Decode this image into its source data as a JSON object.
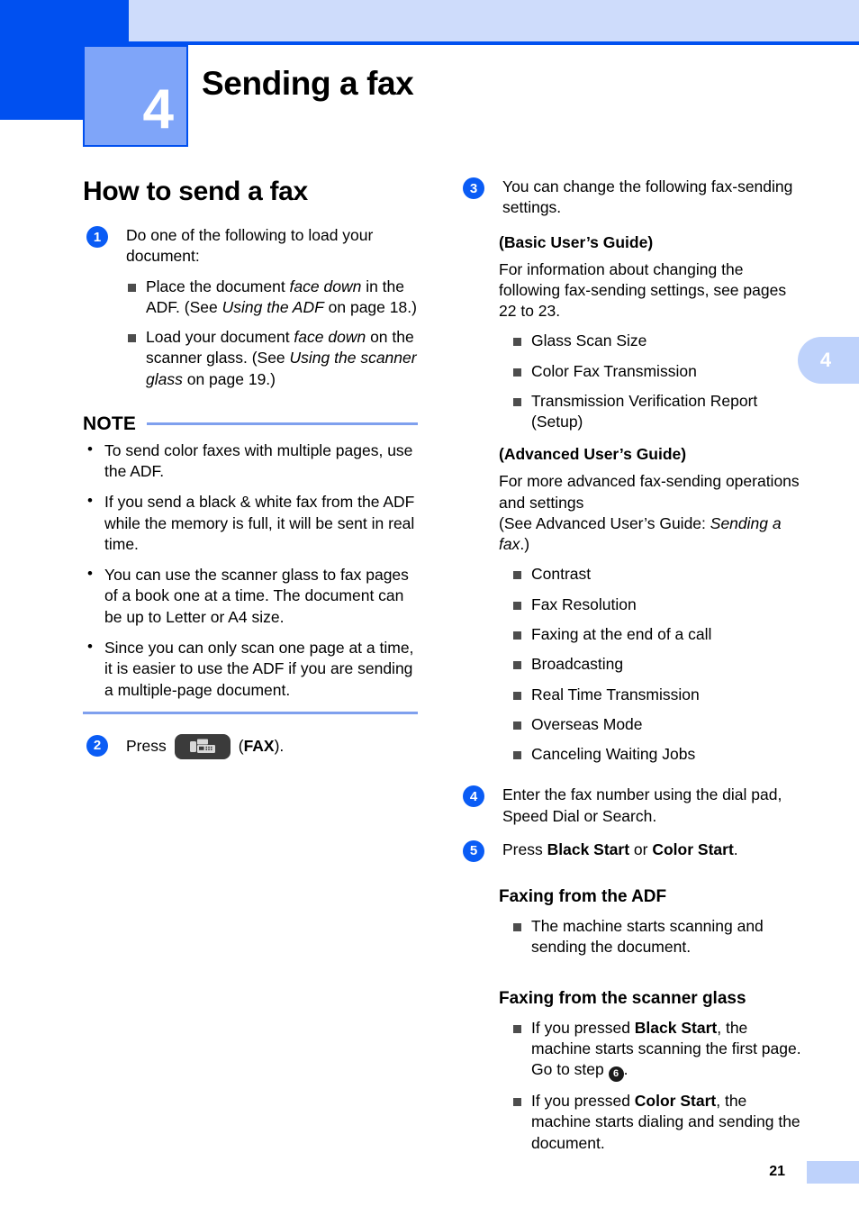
{
  "header": {
    "chapter_number": "4",
    "chapter_title": "Sending a fax",
    "side_tab_number": "4"
  },
  "left_column": {
    "section_title": "How to send a fax",
    "step1": {
      "number": "1",
      "text": "Do one of the following to load your document:",
      "bullets": [
        {
          "pre": "Place the document ",
          "em1": "face down",
          "mid": " in the ADF. (See ",
          "em2": "Using the ADF",
          "post": " on page 18.)"
        },
        {
          "pre": "Load your document ",
          "em1": "face down",
          "mid": " on the scanner glass. (See ",
          "em2": "Using the scanner glass",
          "post": " on page 19.)"
        }
      ]
    },
    "note": {
      "title": "NOTE",
      "items": [
        "To send color faxes with multiple pages, use the ADF.",
        "If you send a black & white fax from the ADF while the memory is full, it will be sent in real time.",
        "You can use the scanner glass to fax pages of a book one at a time. The document can be up to Letter or A4 size.",
        "Since you can only scan one page at a time, it is easier to use the ADF if you are sending a multiple-page document."
      ]
    },
    "step2": {
      "number": "2",
      "press_label": "Press",
      "key_icon": "fax-machine-icon",
      "key_name_open": "(",
      "key_name": "FAX",
      "key_name_close": ")."
    }
  },
  "right_column": {
    "step3": {
      "number": "3",
      "text": "You can change the following fax-sending settings.",
      "basic_guide_heading": "(Basic User’s Guide)",
      "basic_guide_para": "For information about changing the following fax-sending settings, see pages 22 to 23.",
      "basic_items": [
        "Glass Scan Size",
        "Color Fax Transmission",
        "Transmission Verification Report (Setup)"
      ],
      "advanced_guide_heading": "(Advanced User’s Guide)",
      "advanced_para_line1": "For more advanced fax-sending operations and settings",
      "advanced_para_line2_pre": "(See Advanced User’s Guide: ",
      "advanced_para_line2_em": "Sending a fax",
      "advanced_para_line2_post": ".)",
      "advanced_items": [
        "Contrast",
        "Fax Resolution",
        "Faxing at the end of a call",
        "Broadcasting",
        "Real Time Transmission",
        "Overseas Mode",
        "Canceling Waiting Jobs"
      ]
    },
    "step4": {
      "number": "4",
      "text": "Enter the fax number using the dial pad, Speed Dial or Search."
    },
    "step5": {
      "number": "5",
      "pre": "Press ",
      "bold1": "Black Start",
      "mid": " or ",
      "bold2": "Color Start",
      "post": "."
    },
    "adf_heading": "Faxing from the ADF",
    "adf_bullet": "The machine starts scanning and sending the document.",
    "glass_heading": "Faxing from the scanner glass",
    "glass_bullets": {
      "b1_pre": "If you pressed ",
      "b1_bold": "Black Start",
      "b1_mid": ", the machine starts scanning the first page. Go to step ",
      "b1_step": "6",
      "b1_post": ".",
      "b2_pre": "If you pressed ",
      "b2_bold": "Color Start",
      "b2_post": ", the machine starts dialing and sending the document."
    }
  },
  "footer": {
    "page_number": "21"
  },
  "colors": {
    "brand_blue": "#0050f0",
    "light_blue": "#cedcfb",
    "chapter_blue": "#7fa5f9",
    "badge_blue": "#0a5cf5",
    "rule_blue": "#7fa0ee",
    "bullet_gray": "#4d4d4d",
    "key_dark": "#3b3b3b"
  }
}
